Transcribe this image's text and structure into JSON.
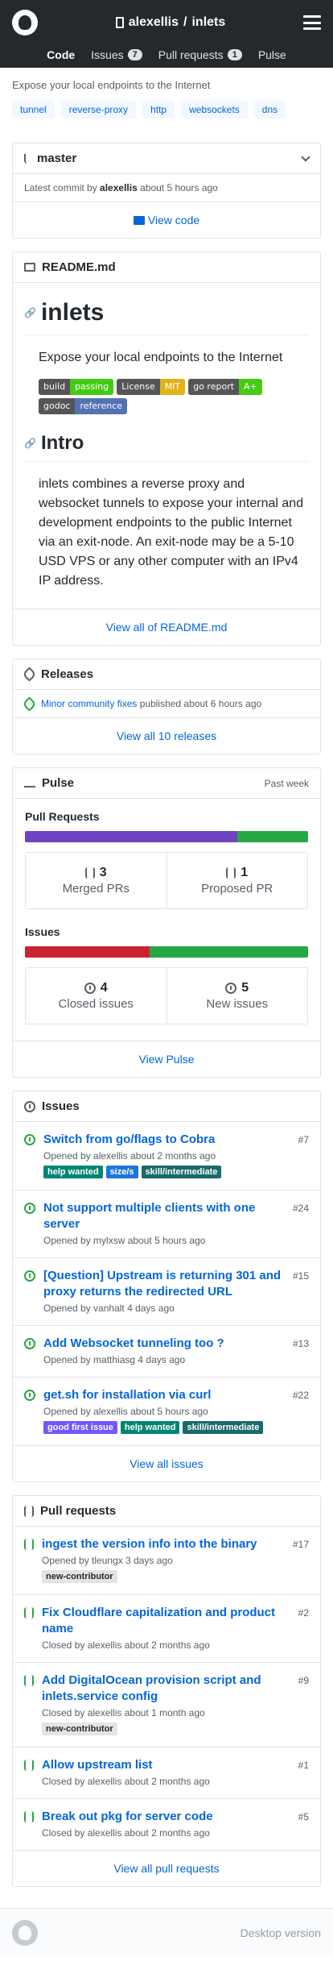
{
  "header": {
    "owner": "alexellis",
    "separator": "/",
    "repo": "inlets"
  },
  "nav": {
    "code": "Code",
    "issues": "Issues",
    "issues_count": "7",
    "pulls": "Pull requests",
    "pulls_count": "1",
    "pulse": "Pulse"
  },
  "repo": {
    "description": "Expose your local endpoints to the Internet",
    "topics": [
      "tunnel",
      "reverse-proxy",
      "http",
      "websockets",
      "dns"
    ]
  },
  "branch": {
    "name": "master",
    "latest_prefix": "Latest commit by",
    "author": "alexellis",
    "time": "about 5 hours ago",
    "view_code": "View code"
  },
  "readme": {
    "file": "README.md",
    "h1": "inlets",
    "tagline": "Expose your local endpoints to the Internet",
    "badges": [
      {
        "l": "build",
        "r": "passing",
        "color": "#4c1"
      },
      {
        "l": "License",
        "r": "MIT",
        "color": "#dfb317"
      },
      {
        "l": "go report",
        "r": "A+",
        "color": "#4c1"
      },
      {
        "l": "godoc",
        "r": "reference",
        "color": "#5272b4"
      }
    ],
    "h2": "Intro",
    "intro": "inlets combines a reverse proxy and websocket tunnels to expose your internal and development endpoints to the public Internet via an exit-node. An exit-node may be a 5-10 USD VPS or any other computer with an IPv4 IP address.",
    "view_all": "View all of README.md"
  },
  "releases": {
    "title": "Releases",
    "latest_name": "Minor community fixes",
    "latest_meta": "published about 6 hours ago",
    "view_all": "View all 10 releases"
  },
  "pulse": {
    "title": "Pulse",
    "period": "Past week",
    "pr_title": "Pull Requests",
    "pr_bar": {
      "merged_fraction": 0.75,
      "merged_color": "#6f42c1",
      "proposed_color": "#28a745"
    },
    "merged_num": "3",
    "merged_label": "Merged PRs",
    "proposed_num": "1",
    "proposed_label": "Proposed PR",
    "issues_title": "Issues",
    "issues_bar": {
      "closed_fraction": 0.44,
      "closed_color": "#cb2431",
      "new_color": "#28a745"
    },
    "closed_num": "4",
    "closed_label": "Closed issues",
    "new_num": "5",
    "new_label": "New issues",
    "view": "View Pulse"
  },
  "issues": {
    "title": "Issues",
    "items": [
      {
        "title": "Switch from go/flags to Cobra",
        "meta": "Opened by alexellis about 2 months ago",
        "num": "#7",
        "labels": [
          {
            "text": "help wanted",
            "bg": "#008672",
            "fg": "#fff"
          },
          {
            "text": "size/s",
            "bg": "#1d76db",
            "fg": "#fff"
          },
          {
            "text": "skill/intermediate",
            "bg": "#1a6a6d",
            "fg": "#fff"
          }
        ]
      },
      {
        "title": "Not support multiple clients with one server",
        "meta": "Opened by mylxsw about 5 hours ago",
        "num": "#24",
        "labels": []
      },
      {
        "title": "[Question] Upstream is returning 301 and proxy returns the redirected URL",
        "meta": "Opened by vanhalt 4 days ago",
        "num": "#15",
        "labels": []
      },
      {
        "title": "Add Websocket tunneling too ?",
        "meta": "Opened by matthiasg 4 days ago",
        "num": "#13",
        "labels": []
      },
      {
        "title": "get.sh for installation via curl",
        "meta": "Opened by alexellis about 5 hours ago",
        "num": "#22",
        "labels": [
          {
            "text": "good first issue",
            "bg": "#7057ff",
            "fg": "#fff"
          },
          {
            "text": "help wanted",
            "bg": "#008672",
            "fg": "#fff"
          },
          {
            "text": "skill/intermediate",
            "bg": "#1a6a6d",
            "fg": "#fff"
          }
        ]
      }
    ],
    "view_all": "View all issues"
  },
  "pulls": {
    "title": "Pull requests",
    "items": [
      {
        "title": "ingest the version info into the binary",
        "meta": "Opened by tleungx 3 days ago",
        "num": "#17",
        "labels": [
          {
            "text": "new-contributor",
            "bg": "#e4e4e4",
            "fg": "#24292e"
          }
        ]
      },
      {
        "title": "Fix Cloudflare capitalization and product name",
        "meta": "Closed by alexellis about 2 months ago",
        "num": "#2",
        "labels": []
      },
      {
        "title": "Add DigitalOcean provision script and inlets.service config",
        "meta": "Closed by alexellis about 1 month ago",
        "num": "#9",
        "labels": [
          {
            "text": "new-contributor",
            "bg": "#e4e4e4",
            "fg": "#24292e"
          }
        ]
      },
      {
        "title": "Allow upstream list",
        "meta": "Closed by alexellis about 2 months ago",
        "num": "#1",
        "labels": []
      },
      {
        "title": "Break out pkg for server code",
        "meta": "Closed by alexellis about 2 months ago",
        "num": "#5",
        "labels": []
      }
    ],
    "view_all": "View all pull requests"
  },
  "footer": {
    "desktop": "Desktop version"
  },
  "icons": {
    "logo": "github-mark-icon",
    "menu": "hamburger-menu-icon"
  }
}
